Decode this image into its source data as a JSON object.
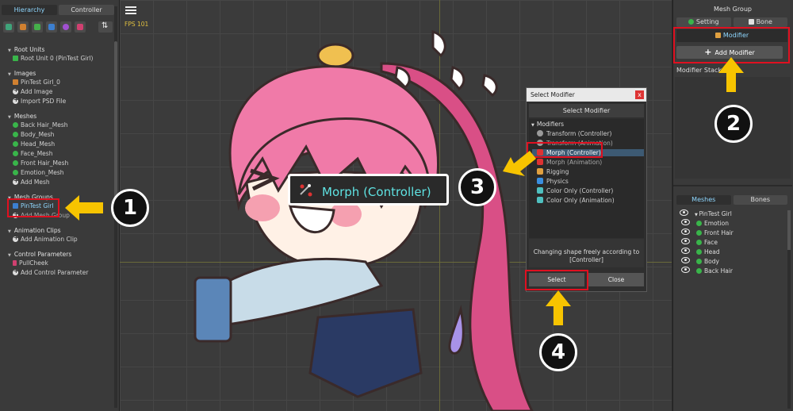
{
  "left_panel": {
    "tabs": [
      "Hierarchy",
      "Controller"
    ],
    "sections": {
      "root_units": {
        "label": "Root Units",
        "items": [
          "Root Unit 0 (PinTest Girl)"
        ]
      },
      "images": {
        "label": "Images",
        "items": [
          "PinTest Girl_0",
          "Add Image",
          "Import PSD File"
        ]
      },
      "meshes": {
        "label": "Meshes",
        "items": [
          "Back Hair_Mesh",
          "Body_Mesh",
          "Head_Mesh",
          "Face_Mesh",
          "Front Hair_Mesh",
          "Emotion_Mesh",
          "Add Mesh"
        ]
      },
      "mesh_groups": {
        "label": "Mesh Groups",
        "items": [
          "PinTest Girl",
          "Add Mesh Group"
        ]
      },
      "animation_clips": {
        "label": "Animation Clips",
        "items": [
          "Add Animation Clip"
        ]
      },
      "control_parameters": {
        "label": "Control Parameters",
        "items": [
          "PullCheek",
          "Add Control Parameter"
        ]
      }
    }
  },
  "canvas": {
    "fps": "FPS 101",
    "tooltip": "Morph (Controller)"
  },
  "right_panel": {
    "title": "Mesh Group",
    "tabs": [
      "Setting",
      "Bone"
    ],
    "modifier_tab": "Modifier",
    "add_modifier": "Add Modifier",
    "stack_label": "Modifier Stack",
    "lower_tabs": [
      "Meshes",
      "Bones"
    ],
    "mesh_root": "PinTest Girl",
    "meshes": [
      "Emotion",
      "Front Hair",
      "Face",
      "Head",
      "Body",
      "Back Hair"
    ]
  },
  "dialog": {
    "title": "Select Modifier",
    "close": "x",
    "header": "Select Modifier",
    "group": "Modifiers",
    "items": [
      "Transform (Controller)",
      "Transform (Animation)",
      "Morph (Controller)",
      "Morph (Animation)",
      "Rigging",
      "Physics",
      "Color Only (Controller)",
      "Color Only (Animation)"
    ],
    "description": "Changing shape freely according to [Controller]",
    "select_button": "Select",
    "close_button": "Close"
  },
  "callouts": [
    "1",
    "2",
    "3",
    "4"
  ],
  "colors": {
    "highlight_red": "#e01020",
    "arrow_yellow": "#f7c400",
    "selected_cyan": "#5fe3e3"
  }
}
